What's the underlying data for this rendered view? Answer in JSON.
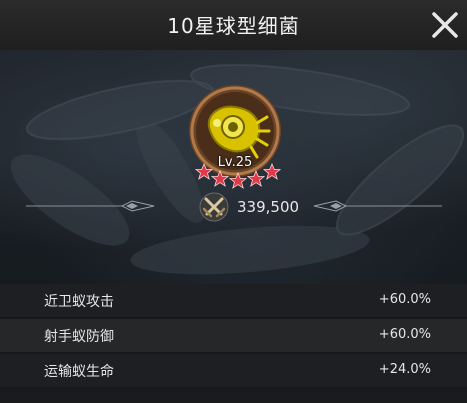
{
  "header": {
    "title": "10星球型细菌",
    "close_icon": "close-icon"
  },
  "unit": {
    "level": "Lv.25",
    "stars": 5,
    "star_color": "#e0394a",
    "badge_icon": "yellow-bacterium-icon",
    "power_icon": "crossed-swords-icon",
    "power": "339,500"
  },
  "stats": [
    {
      "label": "近卫蚁攻击",
      "value": "+60.0%"
    },
    {
      "label": "射手蚁防御",
      "value": "+60.0%"
    },
    {
      "label": "运输蚁生命",
      "value": "+24.0%"
    }
  ],
  "colors": {
    "header_bg": "#262626",
    "badge_ring": "#8a5a34",
    "bacterium": "#e8d000"
  }
}
